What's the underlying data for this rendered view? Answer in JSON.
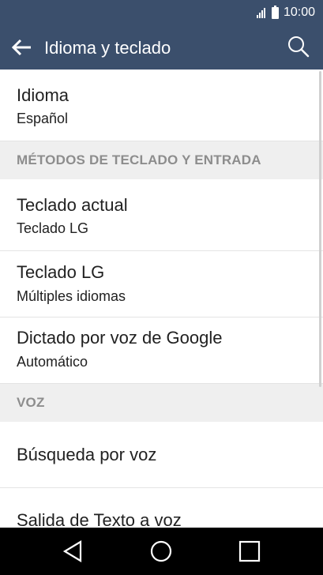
{
  "status_bar": {
    "time": "10:00",
    "icons": [
      "signal-icon",
      "battery-icon"
    ]
  },
  "toolbar": {
    "title": "Idioma y teclado",
    "icons": [
      "back-arrow-icon",
      "search-icon"
    ]
  },
  "items": {
    "idioma": {
      "title": "Idioma",
      "summary": "Español"
    },
    "teclado_actual": {
      "title": "Teclado actual",
      "summary": "Teclado LG"
    },
    "teclado_lg": {
      "title": "Teclado LG",
      "summary": "Múltiples idiomas"
    },
    "dictado": {
      "title": "Dictado por voz de Google",
      "summary": "Automático"
    },
    "busqueda_voz": {
      "title": "Búsqueda por voz"
    },
    "salida_texto": {
      "title": "Salida de Texto a voz"
    }
  },
  "categories": {
    "metodos": "MÉTODOS DE TECLADO Y ENTRADA",
    "voz": "VOZ"
  },
  "nav_bar": {
    "icons": [
      "back-triangle-icon",
      "home-circle-icon",
      "recents-square-icon"
    ]
  },
  "colors": {
    "app_bar": "#3b4f6c",
    "category_background": "#efefef",
    "category_text": "#8d8d8d",
    "nav_bar": "#000000"
  }
}
